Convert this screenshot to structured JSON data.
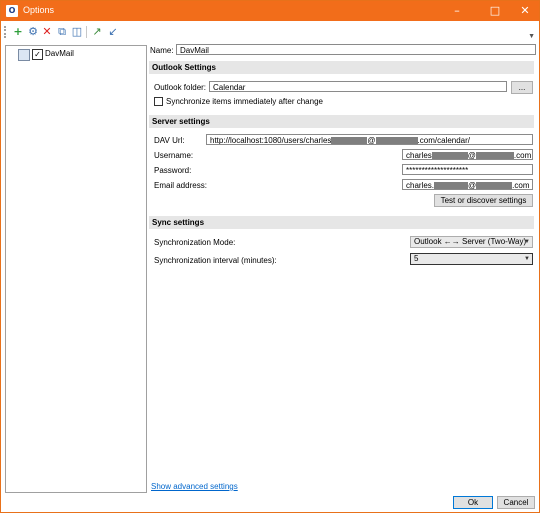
{
  "window": {
    "title": "Options",
    "app_icon": "outlook-caldav-icon"
  },
  "toolbar": {
    "buttons": [
      "add-icon",
      "copy-profile-icon",
      "delete-icon",
      "duplicate-icon",
      "clear-cache-icon",
      "export-icon",
      "import-icon"
    ]
  },
  "tree": {
    "items": [
      {
        "label": "DavMail",
        "checked": true
      }
    ]
  },
  "form": {
    "name_label": "Name:",
    "name_value": "DavMail",
    "outlook_section": "Outlook Settings",
    "outlook_folder_label": "Outlook folder:",
    "outlook_folder_value": "Calendar",
    "browse_label": "...",
    "sync_immediately_label": "Synchronize items immediately after change",
    "server_section": "Server settings",
    "dav_url_label": "DAV Url:",
    "dav_url_prefix": "http://localhost:1080/users/charles",
    "dav_url_at": "@",
    "dav_url_suffix": ".com/calendar/",
    "username_label": "Username:",
    "username_prefix": "charles",
    "username_at": "@",
    "username_suffix": ".com",
    "password_label": "Password:",
    "password_value": "********************",
    "email_label": "Email address:",
    "email_prefix": "charles.",
    "email_at": "@",
    "email_suffix": ".com",
    "test_button": "Test or discover settings",
    "sync_section": "Sync settings",
    "sync_mode_label": "Synchronization Mode:",
    "sync_mode_value": "Outlook ←→ Server (Two-Way)",
    "sync_interval_label": "Synchronization interval (minutes):",
    "sync_interval_value": "5"
  },
  "footer": {
    "advanced_link": "Show advanced settings",
    "ok_label": "Ok",
    "cancel_label": "Cancel"
  }
}
